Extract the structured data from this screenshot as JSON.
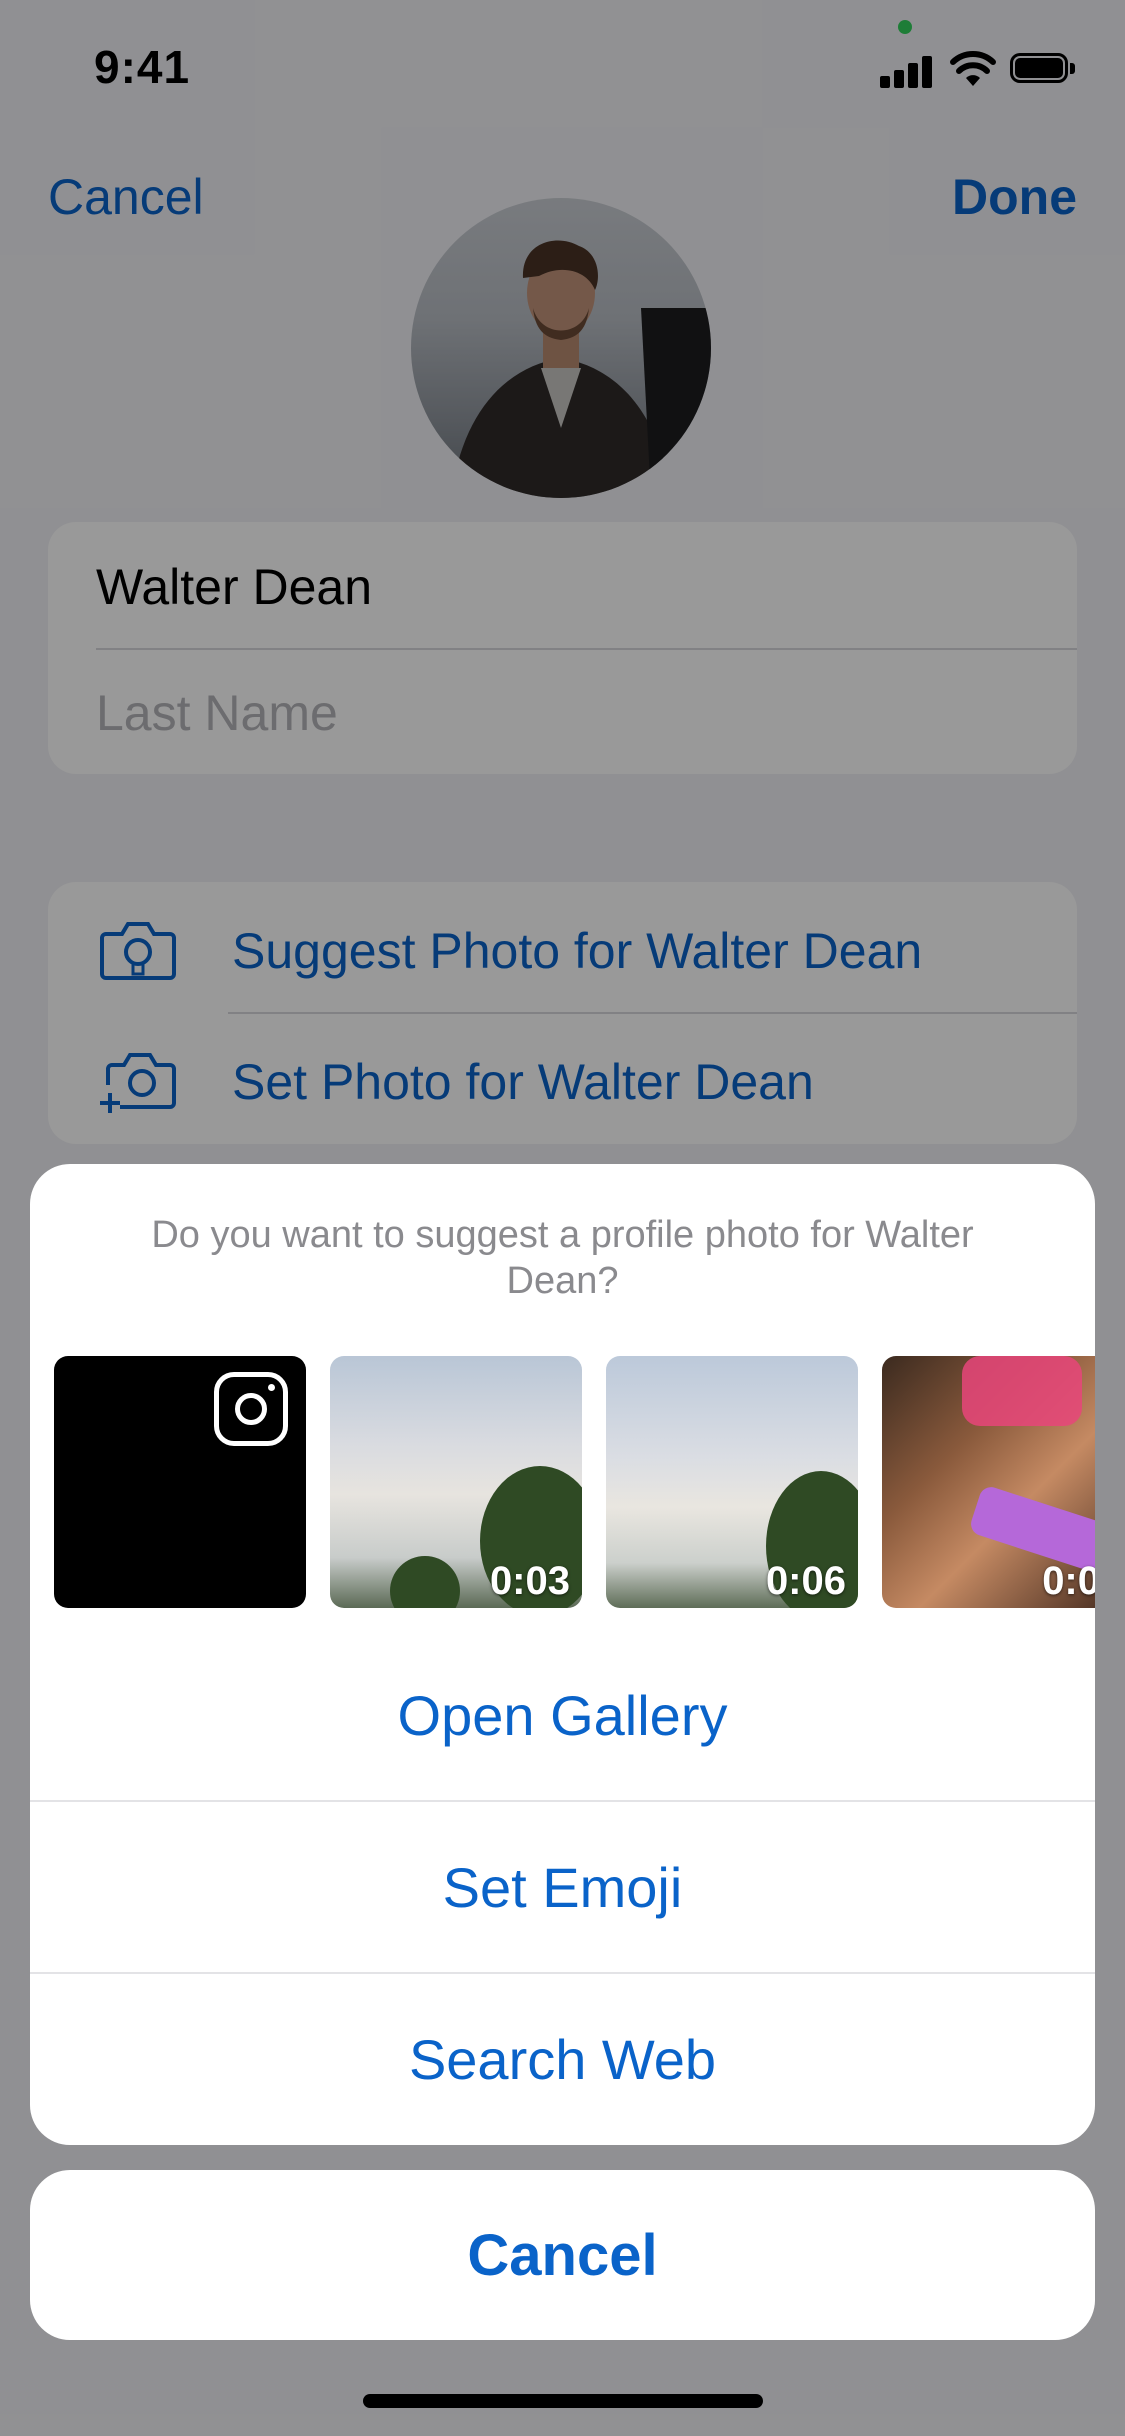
{
  "status_bar": {
    "time": "9:41"
  },
  "nav": {
    "cancel_label": "Cancel",
    "done_label": "Done"
  },
  "form": {
    "first_name_value": "Walter Dean",
    "last_name_placeholder": "Last Name"
  },
  "photo_options": [
    {
      "label": "Suggest Photo for Walter Dean",
      "icon": "camera-suggest-icon"
    },
    {
      "label": "Set Photo for Walter Dean",
      "icon": "camera-add-icon"
    }
  ],
  "sheet": {
    "message": "Do you want to suggest a profile photo for Walter Dean?",
    "thumbnails": [
      {
        "kind": "instagram",
        "icon": "instagram-icon"
      },
      {
        "kind": "video",
        "duration": "0:03"
      },
      {
        "kind": "video",
        "duration": "0:06"
      },
      {
        "kind": "video",
        "duration": "0:0"
      }
    ],
    "actions": [
      "Open Gallery",
      "Set Emoji",
      "Search Web"
    ],
    "cancel_label": "Cancel"
  },
  "colors": {
    "accent": "#0a63c9",
    "dim_overlay": "rgba(0,0,0,0.40)"
  }
}
